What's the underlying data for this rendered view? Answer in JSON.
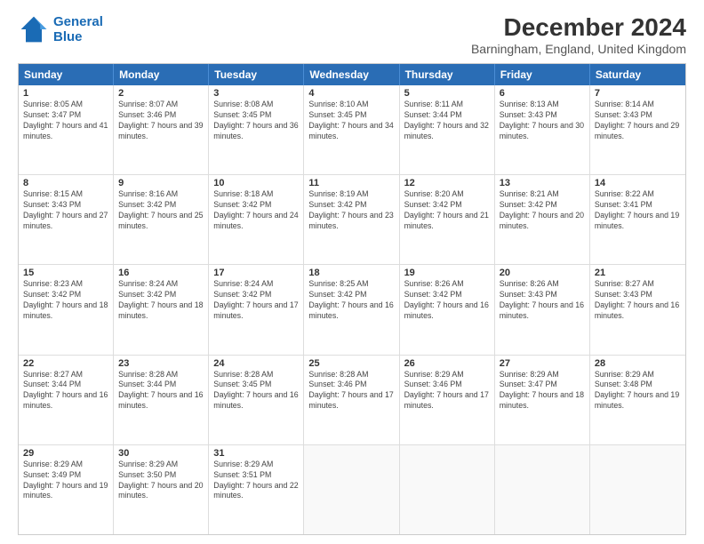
{
  "logo": {
    "line1": "General",
    "line2": "Blue"
  },
  "title": "December 2024",
  "subtitle": "Barningham, England, United Kingdom",
  "header_days": [
    "Sunday",
    "Monday",
    "Tuesday",
    "Wednesday",
    "Thursday",
    "Friday",
    "Saturday"
  ],
  "weeks": [
    [
      {
        "day": "1",
        "sunrise": "Sunrise: 8:05 AM",
        "sunset": "Sunset: 3:47 PM",
        "daylight": "Daylight: 7 hours and 41 minutes."
      },
      {
        "day": "2",
        "sunrise": "Sunrise: 8:07 AM",
        "sunset": "Sunset: 3:46 PM",
        "daylight": "Daylight: 7 hours and 39 minutes."
      },
      {
        "day": "3",
        "sunrise": "Sunrise: 8:08 AM",
        "sunset": "Sunset: 3:45 PM",
        "daylight": "Daylight: 7 hours and 36 minutes."
      },
      {
        "day": "4",
        "sunrise": "Sunrise: 8:10 AM",
        "sunset": "Sunset: 3:45 PM",
        "daylight": "Daylight: 7 hours and 34 minutes."
      },
      {
        "day": "5",
        "sunrise": "Sunrise: 8:11 AM",
        "sunset": "Sunset: 3:44 PM",
        "daylight": "Daylight: 7 hours and 32 minutes."
      },
      {
        "day": "6",
        "sunrise": "Sunrise: 8:13 AM",
        "sunset": "Sunset: 3:43 PM",
        "daylight": "Daylight: 7 hours and 30 minutes."
      },
      {
        "day": "7",
        "sunrise": "Sunrise: 8:14 AM",
        "sunset": "Sunset: 3:43 PM",
        "daylight": "Daylight: 7 hours and 29 minutes."
      }
    ],
    [
      {
        "day": "8",
        "sunrise": "Sunrise: 8:15 AM",
        "sunset": "Sunset: 3:43 PM",
        "daylight": "Daylight: 7 hours and 27 minutes."
      },
      {
        "day": "9",
        "sunrise": "Sunrise: 8:16 AM",
        "sunset": "Sunset: 3:42 PM",
        "daylight": "Daylight: 7 hours and 25 minutes."
      },
      {
        "day": "10",
        "sunrise": "Sunrise: 8:18 AM",
        "sunset": "Sunset: 3:42 PM",
        "daylight": "Daylight: 7 hours and 24 minutes."
      },
      {
        "day": "11",
        "sunrise": "Sunrise: 8:19 AM",
        "sunset": "Sunset: 3:42 PM",
        "daylight": "Daylight: 7 hours and 23 minutes."
      },
      {
        "day": "12",
        "sunrise": "Sunrise: 8:20 AM",
        "sunset": "Sunset: 3:42 PM",
        "daylight": "Daylight: 7 hours and 21 minutes."
      },
      {
        "day": "13",
        "sunrise": "Sunrise: 8:21 AM",
        "sunset": "Sunset: 3:42 PM",
        "daylight": "Daylight: 7 hours and 20 minutes."
      },
      {
        "day": "14",
        "sunrise": "Sunrise: 8:22 AM",
        "sunset": "Sunset: 3:41 PM",
        "daylight": "Daylight: 7 hours and 19 minutes."
      }
    ],
    [
      {
        "day": "15",
        "sunrise": "Sunrise: 8:23 AM",
        "sunset": "Sunset: 3:42 PM",
        "daylight": "Daylight: 7 hours and 18 minutes."
      },
      {
        "day": "16",
        "sunrise": "Sunrise: 8:24 AM",
        "sunset": "Sunset: 3:42 PM",
        "daylight": "Daylight: 7 hours and 18 minutes."
      },
      {
        "day": "17",
        "sunrise": "Sunrise: 8:24 AM",
        "sunset": "Sunset: 3:42 PM",
        "daylight": "Daylight: 7 hours and 17 minutes."
      },
      {
        "day": "18",
        "sunrise": "Sunrise: 8:25 AM",
        "sunset": "Sunset: 3:42 PM",
        "daylight": "Daylight: 7 hours and 16 minutes."
      },
      {
        "day": "19",
        "sunrise": "Sunrise: 8:26 AM",
        "sunset": "Sunset: 3:42 PM",
        "daylight": "Daylight: 7 hours and 16 minutes."
      },
      {
        "day": "20",
        "sunrise": "Sunrise: 8:26 AM",
        "sunset": "Sunset: 3:43 PM",
        "daylight": "Daylight: 7 hours and 16 minutes."
      },
      {
        "day": "21",
        "sunrise": "Sunrise: 8:27 AM",
        "sunset": "Sunset: 3:43 PM",
        "daylight": "Daylight: 7 hours and 16 minutes."
      }
    ],
    [
      {
        "day": "22",
        "sunrise": "Sunrise: 8:27 AM",
        "sunset": "Sunset: 3:44 PM",
        "daylight": "Daylight: 7 hours and 16 minutes."
      },
      {
        "day": "23",
        "sunrise": "Sunrise: 8:28 AM",
        "sunset": "Sunset: 3:44 PM",
        "daylight": "Daylight: 7 hours and 16 minutes."
      },
      {
        "day": "24",
        "sunrise": "Sunrise: 8:28 AM",
        "sunset": "Sunset: 3:45 PM",
        "daylight": "Daylight: 7 hours and 16 minutes."
      },
      {
        "day": "25",
        "sunrise": "Sunrise: 8:28 AM",
        "sunset": "Sunset: 3:46 PM",
        "daylight": "Daylight: 7 hours and 17 minutes."
      },
      {
        "day": "26",
        "sunrise": "Sunrise: 8:29 AM",
        "sunset": "Sunset: 3:46 PM",
        "daylight": "Daylight: 7 hours and 17 minutes."
      },
      {
        "day": "27",
        "sunrise": "Sunrise: 8:29 AM",
        "sunset": "Sunset: 3:47 PM",
        "daylight": "Daylight: 7 hours and 18 minutes."
      },
      {
        "day": "28",
        "sunrise": "Sunrise: 8:29 AM",
        "sunset": "Sunset: 3:48 PM",
        "daylight": "Daylight: 7 hours and 19 minutes."
      }
    ],
    [
      {
        "day": "29",
        "sunrise": "Sunrise: 8:29 AM",
        "sunset": "Sunset: 3:49 PM",
        "daylight": "Daylight: 7 hours and 19 minutes."
      },
      {
        "day": "30",
        "sunrise": "Sunrise: 8:29 AM",
        "sunset": "Sunset: 3:50 PM",
        "daylight": "Daylight: 7 hours and 20 minutes."
      },
      {
        "day": "31",
        "sunrise": "Sunrise: 8:29 AM",
        "sunset": "Sunset: 3:51 PM",
        "daylight": "Daylight: 7 hours and 22 minutes."
      },
      null,
      null,
      null,
      null
    ]
  ]
}
